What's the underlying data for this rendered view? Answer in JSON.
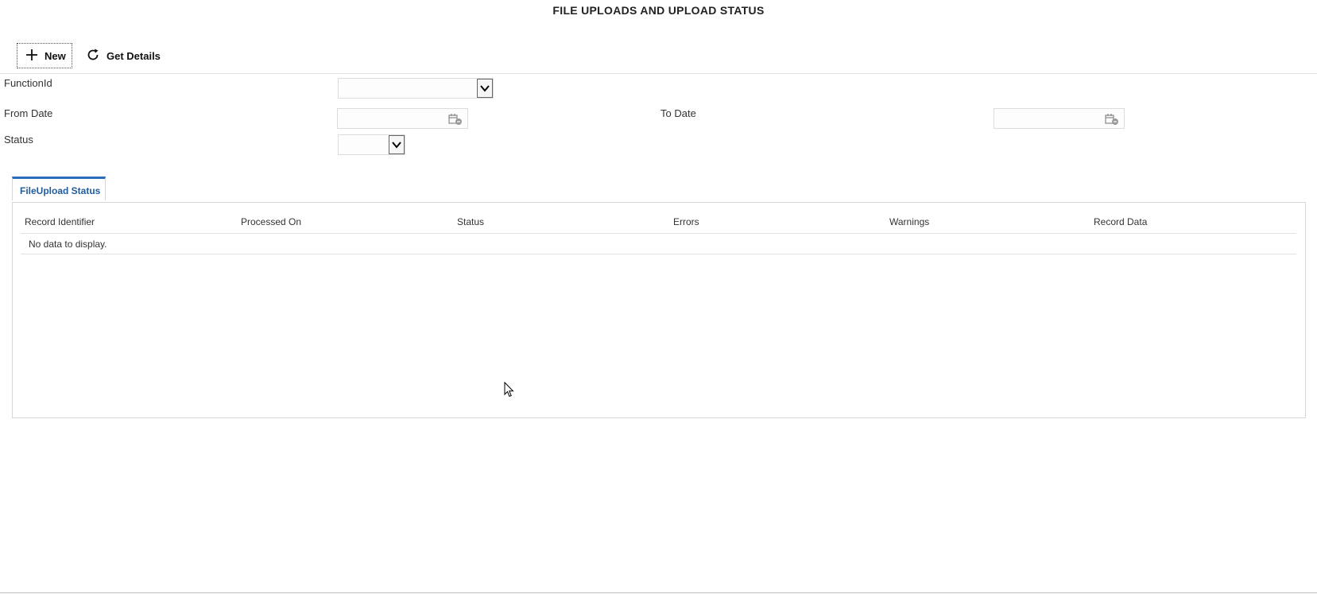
{
  "page": {
    "title": "FILE UPLOADS AND UPLOAD STATUS"
  },
  "toolbar": {
    "new_label": "New",
    "get_details_label": "Get Details"
  },
  "form": {
    "function_id_label": "FunctionId",
    "function_id_value": "",
    "from_date_label": "From Date",
    "from_date_value": "",
    "to_date_label": "To Date",
    "to_date_value": "",
    "status_label": "Status",
    "status_value": ""
  },
  "tabs": [
    {
      "label": "FileUpload Status",
      "active": true
    }
  ],
  "grid": {
    "columns": [
      "Record Identifier",
      "Processed On",
      "Status",
      "Errors",
      "Warnings",
      "Record Data"
    ],
    "empty_message": "No data to display."
  },
  "colors": {
    "accent": "#2a6ebb",
    "tab_text": "#1f5c9e"
  },
  "icons": {
    "new": "plus-icon",
    "get_details": "refresh-icon",
    "date": "calendar-icon",
    "select": "chevron-down-icon"
  }
}
